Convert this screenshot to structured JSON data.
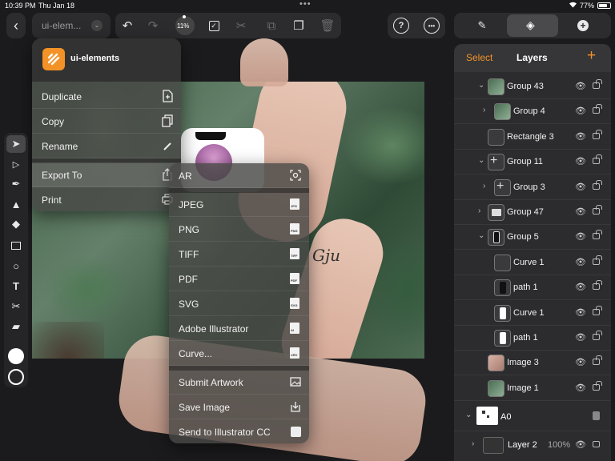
{
  "status": {
    "time": "10:39 PM",
    "date": "Thu Jan 18",
    "battery": "77%",
    "battery_level": 0.77
  },
  "toolbar": {
    "doc_title": "ui-elem...",
    "zoom": "11%"
  },
  "doc_menu": {
    "title": "ui-elements",
    "items": [
      {
        "label": "Duplicate"
      },
      {
        "label": "Copy"
      },
      {
        "label": "Rename"
      },
      {
        "label": "Export To"
      },
      {
        "label": "Print"
      }
    ]
  },
  "export_menu": {
    "items": [
      "AR",
      "JPEG",
      "PNG",
      "TIFF",
      "PDF",
      "SVG",
      "Adobe Illustrator",
      "Curve...",
      "Submit Artwork",
      "Save Image",
      "Send to Illustrator CC"
    ],
    "file_badges": [
      "JPG",
      "PNG",
      "TIFF",
      "PDF",
      "SVG",
      "AI",
      "CRV"
    ]
  },
  "layers_panel": {
    "select_label": "Select",
    "title": "Layers",
    "add_label": "+",
    "layers": [
      {
        "name": "Group 43"
      },
      {
        "name": "Group 4"
      },
      {
        "name": "Rectangle 3"
      },
      {
        "name": "Group 11"
      },
      {
        "name": "Group 3"
      },
      {
        "name": "Group 47"
      },
      {
        "name": "Group 5"
      },
      {
        "name": "Curve 1"
      },
      {
        "name": "path 1"
      },
      {
        "name": "Curve 1"
      },
      {
        "name": "path 1"
      },
      {
        "name": "Image 3"
      },
      {
        "name": "Image 1"
      }
    ],
    "artboard": {
      "name": "A0"
    },
    "bottom_layer": {
      "name": "Layer 2",
      "opacity": "100%"
    }
  },
  "canvas": {
    "tattoo_text": "Gju"
  }
}
